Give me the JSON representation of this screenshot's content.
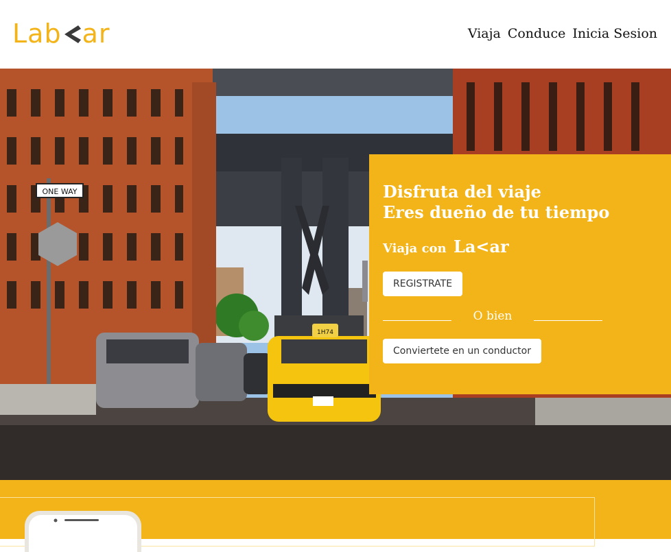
{
  "header": {
    "logo_left": "Lab",
    "logo_right": "ar",
    "nav": [
      "Viaja",
      "Conduce",
      "Inicia Sesion"
    ]
  },
  "promo": {
    "headline_line1": "Disfruta del viaje",
    "headline_line2": "Eres dueño de tu tiempo",
    "sub_prefix": "Viaja con",
    "sub_brand": "La<ar",
    "register_button": "REGISTRATE",
    "or_text": "O bien",
    "driver_button": "Conviertete en un conductor"
  },
  "hero": {
    "sign_text": "ONE WAY",
    "taxi_roof": "1H74"
  },
  "colors": {
    "brand_yellow": "#f2b418",
    "logo_chevron": "#3a3a3a"
  }
}
